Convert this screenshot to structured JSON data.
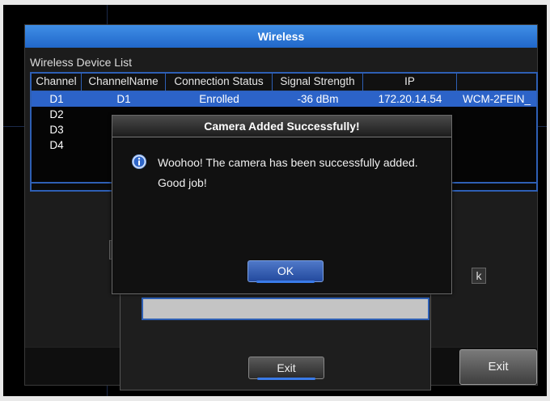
{
  "window": {
    "title": "Wireless"
  },
  "device_list": {
    "label": "Wireless Device List",
    "columns": [
      "Channel",
      "ChannelName",
      "Connection Status",
      "Signal Strength",
      "IP",
      ""
    ],
    "rows": [
      {
        "channel": "D1",
        "name": "D1",
        "status": "Enrolled",
        "signal": "-36 dBm",
        "ip": "172.20.14.54",
        "model": "WCM-2FEIN_"
      },
      {
        "channel": "D2",
        "name": "",
        "status": "",
        "signal": "",
        "ip": "",
        "model": ""
      },
      {
        "channel": "D3",
        "name": "",
        "status": "",
        "signal": "",
        "ip": "",
        "model": ""
      },
      {
        "channel": "D4",
        "name": "",
        "status": "",
        "signal": "",
        "ip": "",
        "model": ""
      }
    ]
  },
  "main_exit_label": "Exit",
  "sub_dialog": {
    "exit_label": "Exit",
    "partial_button_letter": "k"
  },
  "modal": {
    "title": "Camera Added Successfully!",
    "message": "Woohoo! The camera has been successfully added. Good job!",
    "ok_label": "OK",
    "icon": "info-icon"
  },
  "colors": {
    "accent_blue": "#2c63c8",
    "title_blue": "#2f7bdc",
    "selected_row": "#2c63c8"
  }
}
